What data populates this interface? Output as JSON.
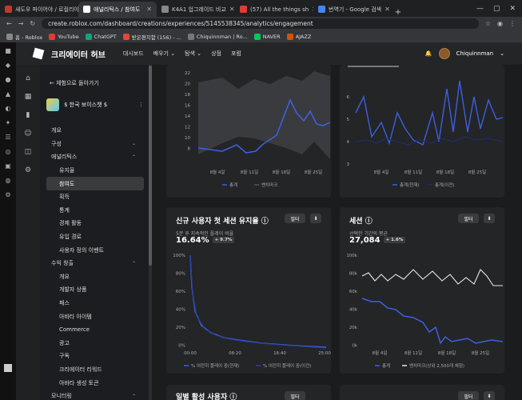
{
  "browser": {
    "tabs": [
      {
        "label": "새도우 파이어야 / 로컬리아",
        "color": "#c0392b"
      },
      {
        "label": "애널리틱스 / 참여도",
        "color": "#ffffff",
        "active": true
      },
      {
        "label": "K4A1 업그레이드 비교",
        "color": "#888888"
      },
      {
        "label": "(57) All the things sh",
        "color": "#e53935"
      },
      {
        "label": "번역기 - Google 검색",
        "color": "#4285f4"
      }
    ],
    "url": "create.roblox.com/dashboard/creations/experiences/5145538345/analytics/engagement",
    "bookmarks": [
      {
        "label": "홈 - Roblox",
        "color": "#888888"
      },
      {
        "label": "YouTube",
        "color": "#e53935"
      },
      {
        "label": "ChatGPT",
        "color": "#10a37f"
      },
      {
        "label": "받은편지함 (156) - ...",
        "color": "#ea4335"
      },
      {
        "label": "Chiquinnman | Ro...",
        "color": "#777777"
      },
      {
        "label": "NAVER",
        "color": "#03c75a"
      },
      {
        "label": "AJAZZ",
        "color": "#d35400"
      }
    ]
  },
  "topnav": {
    "brand": "크리에이터 허브",
    "items": [
      "대시보드",
      "배우기 ⌄",
      "탐색 ⌄",
      "상점",
      "포럼"
    ],
    "username": "Chiquinnman"
  },
  "sidebar": {
    "back": "← 체험으로 돌아가기",
    "experience": "$ 한국 보이스챗 $",
    "menu": [
      {
        "label": "개요",
        "level": 0
      },
      {
        "label": "구성",
        "level": 0,
        "chev": "⌄"
      },
      {
        "label": "애널리틱스",
        "level": 0,
        "chev": "⌃"
      },
      {
        "label": "유지율",
        "level": 1
      },
      {
        "label": "참여도",
        "level": 1,
        "selected": true
      },
      {
        "label": "획득",
        "level": 1
      },
      {
        "label": "통계",
        "level": 1
      },
      {
        "label": "경제 활동",
        "level": 1
      },
      {
        "label": "유입 경로",
        "level": 1
      },
      {
        "label": "사용자 정의 이벤트",
        "level": 1
      },
      {
        "label": "수익 창출",
        "level": 0,
        "chev": "⌃"
      },
      {
        "label": "개요",
        "level": 1
      },
      {
        "label": "개발자 상품",
        "level": 1
      },
      {
        "label": "패스",
        "level": 1
      },
      {
        "label": "아바타 아이템",
        "level": 1
      },
      {
        "label": "Commerce",
        "level": 1
      },
      {
        "label": "광고",
        "level": 1
      },
      {
        "label": "구독",
        "level": 1
      },
      {
        "label": "크리에이터 리워드",
        "level": 1
      },
      {
        "label": "아바타 생성 토큰",
        "level": 1
      },
      {
        "label": "모니터링",
        "level": 0,
        "chev": "⌃"
      },
      {
        "label": "성능",
        "level": 1
      }
    ]
  },
  "cards": {
    "top_left": {
      "y_ticks": [
        "22",
        "20",
        "18",
        "16",
        "14",
        "12",
        "10",
        "8"
      ],
      "x_ticks": [
        "8월 4일",
        "8월 11일",
        "8월 18일",
        "8월 25일"
      ],
      "legend": [
        "총계",
        "벤치마크"
      ]
    },
    "top_right": {
      "y_ticks": [
        "6",
        "5",
        "4",
        "3"
      ],
      "x_ticks": [
        "8월 4일",
        "8월 11일",
        "8월 18일",
        "8월 25일"
      ],
      "legend": [
        "총계(현재)",
        "총계(이전)"
      ]
    },
    "retention": {
      "title": "신규 사용자 첫 세션 유지율",
      "info": "ⓘ",
      "subtitle": "5분 후 지속적인 플레이 비율",
      "value": "16.64%",
      "badge": "+ 9.7%",
      "filter": "필터",
      "download": "⬇",
      "y_ticks": [
        "100%",
        "80%",
        "60%",
        "40%",
        "20%",
        "0%"
      ],
      "x_ticks": [
        "00:00",
        "08:20",
        "16:40",
        "25:00"
      ],
      "legend": [
        "% 여전히 플레이 중(현재)",
        "% 여전히 플레이 중(이전)"
      ]
    },
    "sessions": {
      "title": "세션",
      "info": "ⓘ",
      "subtitle": "선택한 기간의 평균",
      "value": "27,084",
      "badge": "+ 1.6%",
      "filter": "필터",
      "download": "⬇",
      "y_ticks": [
        "100k",
        "80k",
        "60k",
        "40k",
        "20k",
        "0k"
      ],
      "x_ticks": [
        "8월 4일",
        "8월 11일",
        "8월 18일",
        "8월 25일"
      ],
      "legend": [
        "총계",
        "벤치마크(상위 2,500개 체험)"
      ]
    },
    "dau": {
      "title": "일별 활성 사용자",
      "info": "ⓘ",
      "filter": "필터"
    }
  },
  "colors": {
    "accent": "#3f5fe0",
    "white_line": "#e8e8e8",
    "band": "#3a3b3e"
  }
}
